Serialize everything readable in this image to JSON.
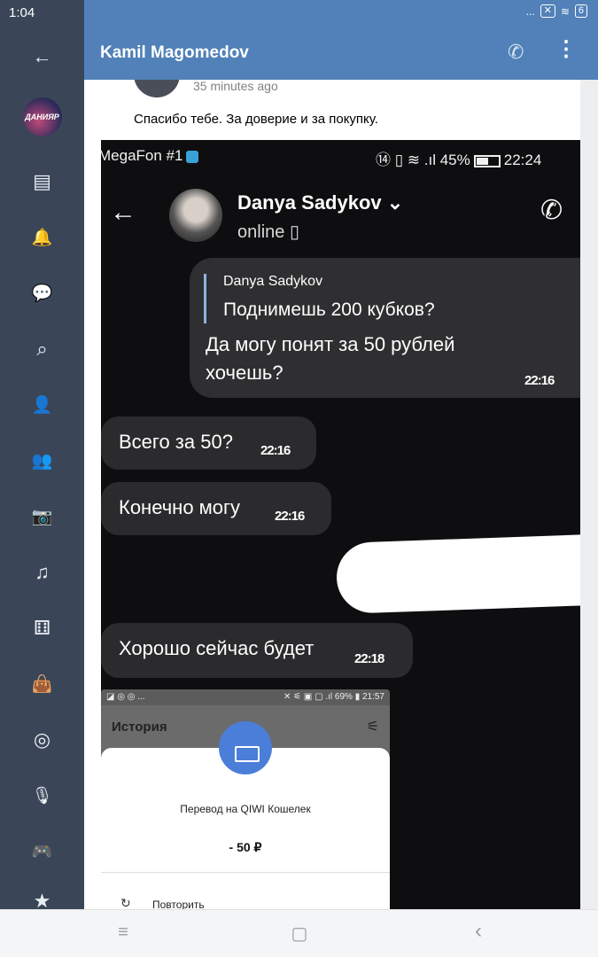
{
  "status_bar": {
    "time": "1:04",
    "dots": "...",
    "battery": "6"
  },
  "sidebar": {
    "profile_badge": "ДАНИЯР",
    "items": [
      {
        "icon": "back-arrow-icon",
        "glyph": "←"
      },
      {
        "icon": "news-icon",
        "glyph": "▤"
      },
      {
        "icon": "bell-icon",
        "glyph": "🔔"
      },
      {
        "icon": "messages-icon",
        "glyph": "💬"
      },
      {
        "icon": "search-icon",
        "glyph": "⌕"
      },
      {
        "icon": "profile-icon",
        "glyph": "👤"
      },
      {
        "icon": "friends-icon",
        "glyph": "👥"
      },
      {
        "icon": "camera-icon",
        "glyph": "📷"
      },
      {
        "icon": "music-icon",
        "glyph": "♫"
      },
      {
        "icon": "games-icon",
        "glyph": "⚅"
      },
      {
        "icon": "shop-icon",
        "glyph": "👜"
      },
      {
        "icon": "target-icon",
        "glyph": "◎"
      },
      {
        "icon": "podcast-icon",
        "glyph": "🎙"
      },
      {
        "icon": "gamepad-icon",
        "glyph": "🎮"
      },
      {
        "icon": "star-icon",
        "glyph": "★"
      }
    ]
  },
  "header": {
    "title": "Kamil Magomedov",
    "phone_glyph": "✆",
    "more_glyph": "⋮"
  },
  "post": {
    "time": "35 minutes ago",
    "text": "Спасибо тебе. За доверие и за покупку."
  },
  "screenshot": {
    "carrier": "MegaFon #1",
    "status_right": "⑭ ▯ ≋ .ıl 45%",
    "clock": "22:24",
    "contact_name": "Danya Sadykov",
    "contact_chevron": "⌄",
    "contact_status": "online",
    "messages": [
      {
        "reply_name": "Danya Sadykov",
        "reply_text": "Поднимешь 200 кубков?",
        "text": "Да могу понят за 50 рублей хочешь?",
        "time": "22:16"
      },
      {
        "text": "Всего за 50?",
        "time": "22:16"
      },
      {
        "text": "Конечно могу",
        "time": "22:16"
      },
      {
        "text": "Хорошо сейчас будет",
        "time": "22:18"
      }
    ],
    "qiwi": {
      "status_left": "◪ ◎ ◎ ...",
      "status_right": "✕ ⚟ ▣ ▢ .ıl 69% ▮ 21:57",
      "title": "История",
      "filter_glyph": "⚟",
      "label": "Перевод на QIWI Кошелек",
      "amount": "- 50 ₽",
      "repeat": "Повторить"
    }
  },
  "navbar": {
    "menu": "≡",
    "home": "▢",
    "back": "‹"
  }
}
